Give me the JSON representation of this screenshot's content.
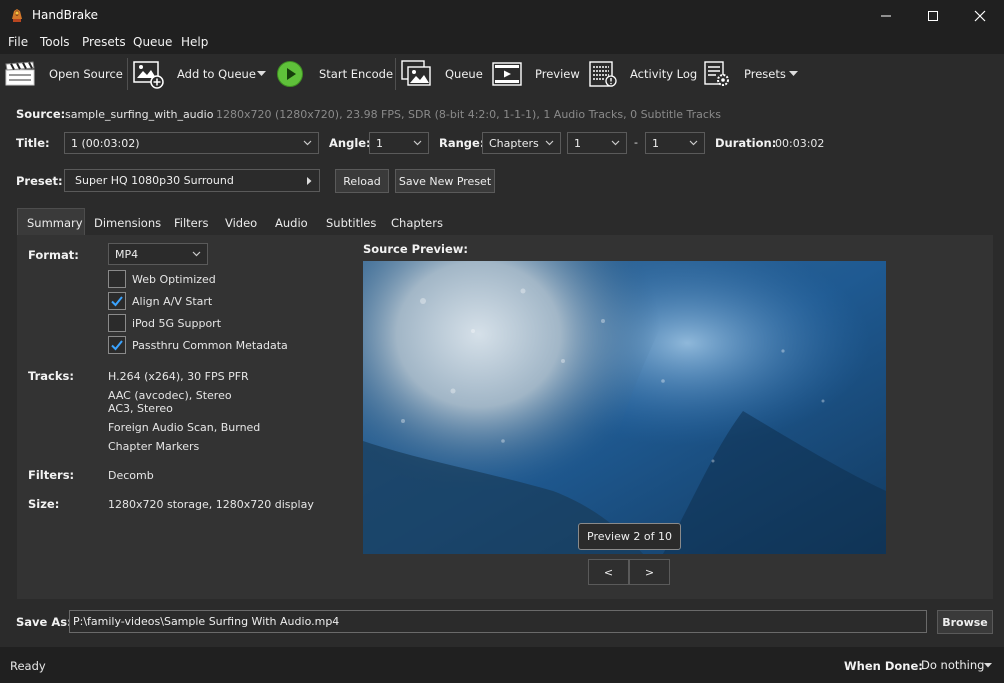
{
  "window": {
    "title": "HandBrake"
  },
  "menu": [
    "File",
    "Tools",
    "Presets",
    "Queue",
    "Help"
  ],
  "toolbar": {
    "open_source": "Open Source",
    "add_to_queue": "Add to Queue",
    "start_encode": "Start Encode",
    "queue": "Queue",
    "preview": "Preview",
    "activity_log": "Activity Log",
    "presets": "Presets"
  },
  "source": {
    "label": "Source:",
    "name": "sample_surfing_with_audio",
    "info": "1280x720 (1280x720), 23.98 FPS, SDR (8-bit 4:2:0, 1-1-1), 1 Audio Tracks, 0 Subtitle Tracks"
  },
  "title_row": {
    "title_label": "Title:",
    "title_value": "1  (00:03:02)",
    "angle_label": "Angle:",
    "angle_value": "1",
    "range_label": "Range:",
    "range_value": "Chapters",
    "range_start": "1",
    "range_sep": "-",
    "range_end": "1",
    "duration_label": "Duration:",
    "duration_value": "00:03:02"
  },
  "preset_row": {
    "label": "Preset:",
    "value": "Super HQ 1080p30 Surround",
    "reload": "Reload",
    "save_new": "Save New Preset"
  },
  "tabs": [
    "Summary",
    "Dimensions",
    "Filters",
    "Video",
    "Audio",
    "Subtitles",
    "Chapters"
  ],
  "summary": {
    "format_label": "Format:",
    "format_value": "MP4",
    "checkboxes": [
      {
        "label": "Web Optimized",
        "checked": false
      },
      {
        "label": "Align A/V Start",
        "checked": true
      },
      {
        "label": "iPod 5G Support",
        "checked": false
      },
      {
        "label": "Passthru Common Metadata",
        "checked": true
      }
    ],
    "tracks_label": "Tracks:",
    "tracks": [
      "H.264 (x264), 30 FPS PFR",
      "AAC (avcodec), Stereo",
      "AC3, Stereo",
      "Foreign Audio Scan, Burned",
      "Chapter Markers"
    ],
    "filters_label": "Filters:",
    "filters_value": "Decomb",
    "size_label": "Size:",
    "size_value": "1280x720 storage, 1280x720 display"
  },
  "preview": {
    "label": "Source Preview:",
    "badge": "Preview 2 of 10",
    "prev": "<",
    "next": ">"
  },
  "save": {
    "label": "Save As:",
    "path": "P:\\family-videos\\Sample Surfing With Audio.mp4",
    "browse": "Browse"
  },
  "status": {
    "text": "Ready",
    "when_done_label": "When Done:",
    "when_done_value": "Do nothing"
  },
  "colors": {
    "accent": "#3aa3ff",
    "play_green": "#5fc13a"
  }
}
